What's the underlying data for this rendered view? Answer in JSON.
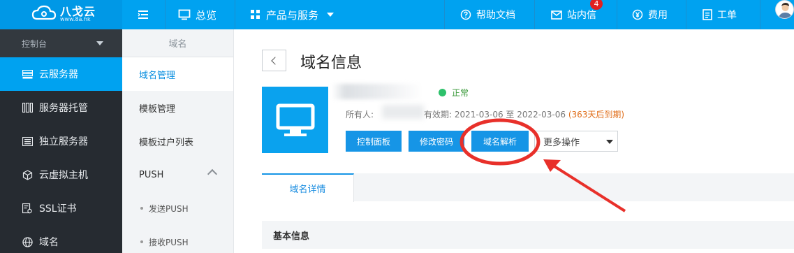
{
  "brand": {
    "name": "八戈云",
    "url": "www.8a.hk"
  },
  "topbar": {
    "overview": "总览",
    "products": "产品与服务",
    "help": "帮助文档",
    "messages": "站内信",
    "messages_badge": "4",
    "billing": "费用",
    "tickets": "工单"
  },
  "sidebar": {
    "console": "控制台",
    "items": [
      {
        "label": "云服务器",
        "icon": "server-icon",
        "active": true
      },
      {
        "label": "服务器托管",
        "icon": "rack-icon",
        "active": false
      },
      {
        "label": "独立服务器",
        "icon": "list-icon",
        "active": false
      },
      {
        "label": "云虚拟主机",
        "icon": "cube-icon",
        "active": false
      },
      {
        "label": "SSL证书",
        "icon": "certificate-icon",
        "active": false
      },
      {
        "label": "域名",
        "icon": "globe-icon",
        "active": false
      }
    ]
  },
  "submenu": {
    "title": "域名",
    "items": [
      {
        "label": "域名管理",
        "active": true
      },
      {
        "label": "模板管理"
      },
      {
        "label": "模板过户列表"
      },
      {
        "label": "PUSH"
      }
    ],
    "push_children": [
      "发送PUSH",
      "接收PUSH"
    ]
  },
  "main": {
    "title": "域名信息",
    "status": "正常",
    "owner_label": "所有人:",
    "validity_label": "有效期:",
    "validity_range": "2021-03-06 至 2022-03-06",
    "validity_remaining": "(363天后到期)",
    "buttons": {
      "control_panel": "控制面板",
      "change_password": "修改密码",
      "dns_resolve": "域名解析"
    },
    "more_actions": "更多操作",
    "tab": "域名详情",
    "section": "基本信息"
  },
  "colors": {
    "primary": "#00a2f0",
    "sidebar_bg": "#262b31",
    "status_green": "#2ec16b",
    "warning": "#e06e1a",
    "annotation_red": "#e8302a"
  }
}
